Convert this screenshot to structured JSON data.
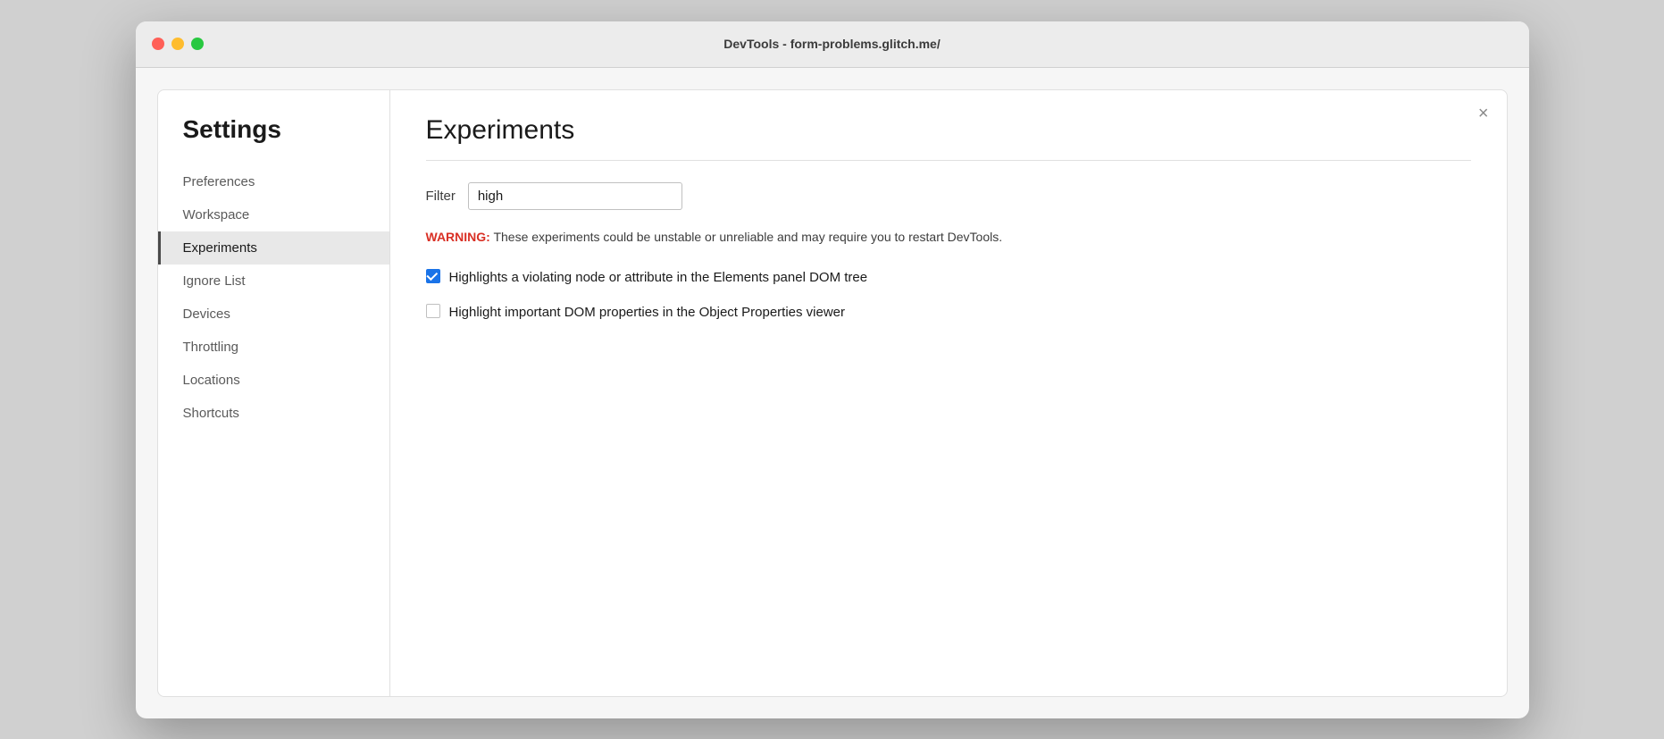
{
  "window": {
    "title": "DevTools - form-problems.glitch.me/"
  },
  "sidebar": {
    "heading": "Settings",
    "items": [
      {
        "id": "preferences",
        "label": "Preferences",
        "active": false
      },
      {
        "id": "workspace",
        "label": "Workspace",
        "active": false
      },
      {
        "id": "experiments",
        "label": "Experiments",
        "active": true
      },
      {
        "id": "ignore-list",
        "label": "Ignore List",
        "active": false
      },
      {
        "id": "devices",
        "label": "Devices",
        "active": false
      },
      {
        "id": "throttling",
        "label": "Throttling",
        "active": false
      },
      {
        "id": "locations",
        "label": "Locations",
        "active": false
      },
      {
        "id": "shortcuts",
        "label": "Shortcuts",
        "active": false
      }
    ]
  },
  "main": {
    "page_title": "Experiments",
    "filter_label": "Filter",
    "filter_value": "high",
    "filter_placeholder": "",
    "warning_label": "WARNING:",
    "warning_text": "These experiments could be unstable or unreliable and may require you to restart DevTools.",
    "experiments": [
      {
        "id": "exp1",
        "checked": true,
        "label": "Highlights a violating node or attribute in the Elements panel DOM tree"
      },
      {
        "id": "exp2",
        "checked": false,
        "label": "Highlight important DOM properties in the Object Properties viewer"
      }
    ]
  },
  "close_button_label": "×",
  "colors": {
    "warning_red": "#d93025",
    "checkbox_blue": "#1a73e8"
  }
}
